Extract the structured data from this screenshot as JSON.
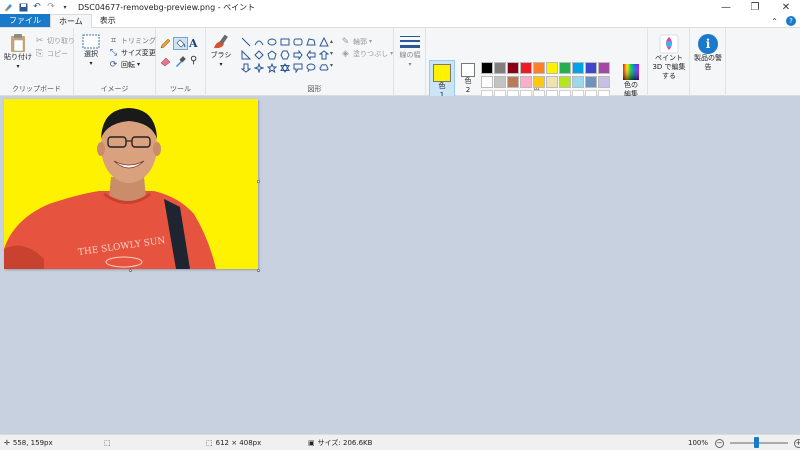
{
  "window": {
    "title": "DSC04677-removebg-preview.png - ペイント"
  },
  "tabs": {
    "file": "ファイル",
    "home": "ホーム",
    "view": "表示"
  },
  "clipboard": {
    "paste_label": "貼り付け",
    "cut_label": "切り取り",
    "copy_label": "コピー",
    "group_label": "クリップボード"
  },
  "image": {
    "select_label": "選択",
    "crop_label": "トリミング",
    "resize_label": "サイズ変更",
    "rotate_label": "回転",
    "group_label": "イメージ"
  },
  "tools": {
    "group_label": "ツール",
    "brush_label": "ブラシ"
  },
  "shapes": {
    "group_label": "図形",
    "outline_label": "輪郭",
    "fill_label": "塗りつぶし",
    "line_width_label": "線の幅"
  },
  "colors": {
    "group_label": "色",
    "color1_label": "色",
    "color1_num": "1",
    "color2_label": "色",
    "color2_num": "2",
    "edit_colors_label": "色の編集",
    "color1_value": "#fff200",
    "color2_value": "#ffffff",
    "palette": [
      "#000000",
      "#7f7f7f",
      "#880015",
      "#ed1c24",
      "#ff7f27",
      "#fff200",
      "#22b14c",
      "#00a2e8",
      "#3f48cc",
      "#a349a4",
      "#ffffff",
      "#c3c3c3",
      "#b97a57",
      "#ffaec9",
      "#ffc90e",
      "#efe4b0",
      "#b5e61d",
      "#99d9ea",
      "#7092be",
      "#c8bfe7",
      "#ffffff",
      "#ffffff",
      "#ffffff",
      "#ffffff",
      "#ffffff",
      "#ffffff",
      "#ffffff",
      "#ffffff",
      "#ffffff",
      "#ffffff"
    ]
  },
  "paint3d": {
    "label": "ペイント 3D で編集する"
  },
  "product_alert": {
    "label": "製品の警告"
  },
  "canvas": {
    "background": "#fff200",
    "shirt_text": "THE SLOWLY SUN"
  },
  "status": {
    "cursor_pos": "558, 159px",
    "selection_size": "",
    "image_size": "612 × 408px",
    "file_size": "サイズ: 206.6KB",
    "zoom": "100%"
  }
}
